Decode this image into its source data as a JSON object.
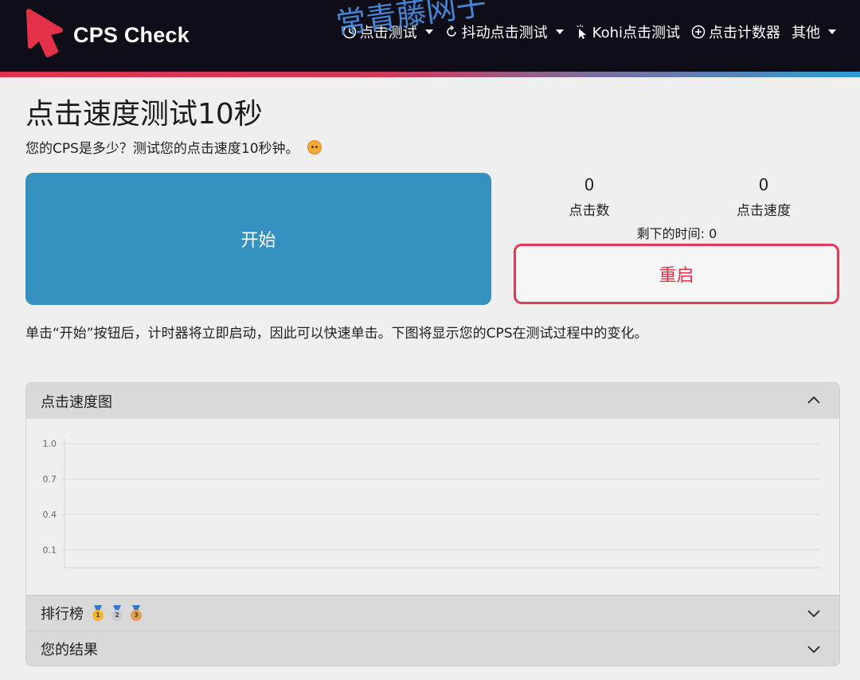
{
  "brand": {
    "name": "CPS Check"
  },
  "nav": {
    "items": [
      {
        "label": "点击测试",
        "icon": "clock-icon",
        "dropdown": true
      },
      {
        "label": "抖动点击测试",
        "icon": "refresh-icon",
        "dropdown": true
      },
      {
        "label": "Kohi点击测试",
        "icon": "cursor-click-icon",
        "dropdown": false
      },
      {
        "label": "点击计数器",
        "icon": "plus-circle-icon",
        "dropdown": false
      },
      {
        "label": "其他",
        "icon": "",
        "dropdown": true
      }
    ]
  },
  "watermark": "常青藤网子",
  "page": {
    "title": "点击速度测试10秒",
    "subtitle": "您的CPS是多少？测试您的点击速度10秒钟。",
    "start_label": "开始",
    "restart_label": "重启",
    "instructions": "单击“开始”按钮后，计时器将立即启动，因此可以快速单击。下图将显示您的CPS在测试过程中的变化。"
  },
  "stats": {
    "clicks_value": "0",
    "clicks_label": "点击数",
    "speed_value": "0",
    "speed_label": "点击速度",
    "time_label": "剩下的时间:",
    "time_value": "0"
  },
  "accordion": {
    "chart_title": "点击速度图",
    "leaderboard_title": "排行榜",
    "results_title": "您的结果",
    "medals": [
      "1",
      "2",
      "3"
    ]
  },
  "chart_data": {
    "type": "line",
    "title": "",
    "xlabel": "",
    "ylabel": "",
    "y_ticks": [
      "1.0",
      "0.7",
      "0.4",
      "0.1"
    ],
    "ylim": [
      0.1,
      1.0
    ],
    "series": [],
    "grid": true
  },
  "colors": {
    "navbar_bg": "#0f0d17",
    "start_button": "#3491bf",
    "restart_accent": "#e23148",
    "brand_logo": "#e23148"
  }
}
